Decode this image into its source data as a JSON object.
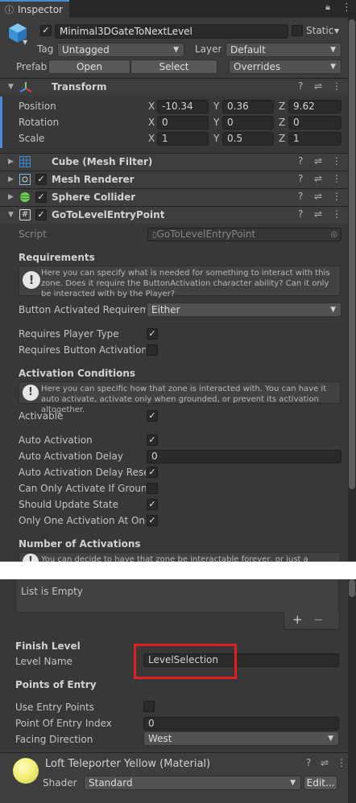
{
  "tab": {
    "title": "Inspector"
  },
  "gameobject": {
    "active": "✓",
    "name": "Minimal3DGateToNextLevel",
    "static_label": "Static",
    "tag_label": "Tag",
    "tag_value": "Untagged",
    "layer_label": "Layer",
    "layer_value": "Default"
  },
  "prefab": {
    "label": "Prefab",
    "open": "Open",
    "select": "Select",
    "overrides": "Overrides"
  },
  "transform": {
    "title": "Transform",
    "position_label": "Position",
    "pos_x": "-10.34",
    "pos_y": "0.36",
    "pos_z": "9.62",
    "rotation_label": "Rotation",
    "rot_x": "0",
    "rot_y": "0",
    "rot_z": "0",
    "scale_label": "Scale",
    "scale_x": "1",
    "scale_y": "0.5",
    "scale_z": "1",
    "x": "X",
    "y": "Y",
    "z": "Z"
  },
  "components": {
    "mesh_filter": "Cube (Mesh Filter)",
    "mesh_renderer": "Mesh Renderer",
    "sphere_collider": "Sphere Collider",
    "script_comp": "GoToLevelEntryPoint"
  },
  "script": {
    "label": "Script",
    "value": "GoToLevelEntryPoint"
  },
  "requirements": {
    "header": "Requirements",
    "help": "Here you can specify what is needed for something to interact with this zone. Does it require the ButtonActivation character ability? Can it only be interacted with by the Player?",
    "button_activated_label": "Button Activated Requireme",
    "button_activated_value": "Either",
    "requires_player_type_label": "Requires Player Type",
    "requires_player_type_value": "✓",
    "requires_button_activation_label": "Requires Button Activation A",
    "requires_button_activation_value": ""
  },
  "activation": {
    "header": "Activation Conditions",
    "help": "Here you can specific how that zone is interacted with. You can have it auto activate, activate only when grounded, or prevent its activation altogether.",
    "activable_label": "Activable",
    "activable_value": "✓",
    "auto_activation_label": "Auto Activation",
    "auto_activation_value": "✓",
    "auto_activation_delay_label": "Auto Activation Delay",
    "auto_activation_delay_value": "0",
    "auto_activation_delay_reset_label": "Auto Activation Delay Reset",
    "auto_activation_delay_reset_value": "✓",
    "can_only_activate_grounded_label": "Can Only Activate If Grounde",
    "can_only_activate_grounded_value": "",
    "should_update_state_label": "Should Update State",
    "should_update_state_value": "✓",
    "only_one_activation_label": "Only One Activation At Once",
    "only_one_activation_value": "✓"
  },
  "number_of_activations": {
    "header": "Number of Activations",
    "help": "You can decide to have that zone be interactable forever, or just a limited"
  },
  "list": {
    "empty": "List is Empty",
    "add": "+",
    "remove": "−"
  },
  "finish_level": {
    "header": "Finish Level",
    "level_name_label": "Level Name",
    "level_name_value": "LevelSelection"
  },
  "points_of_entry": {
    "header": "Points of Entry",
    "use_entry_points_label": "Use Entry Points",
    "use_entry_points_value": "",
    "point_of_entry_index_label": "Point Of Entry Index",
    "point_of_entry_index_value": "0",
    "facing_direction_label": "Facing Direction",
    "facing_direction_value": "West"
  },
  "material": {
    "name": "Loft Teleporter Yellow (Material)",
    "shader_label": "Shader",
    "shader_value": "Standard",
    "edit": "Edit..."
  },
  "colors": {
    "highlight": "#e02020",
    "material_swatch": "#f4f07a",
    "gizmo_blue": "#3a8fd8"
  }
}
